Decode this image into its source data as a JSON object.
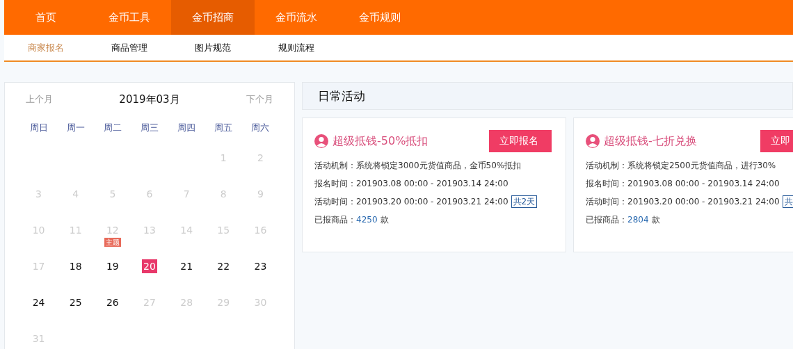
{
  "nav": [
    {
      "label": "首页",
      "selected": false
    },
    {
      "label": "金币工具",
      "selected": false
    },
    {
      "label": "金币招商",
      "selected": true
    },
    {
      "label": "金币流水",
      "selected": false
    },
    {
      "label": "金币规则",
      "selected": false
    }
  ],
  "subnav": [
    {
      "label": "商家报名",
      "selected": true
    },
    {
      "label": "商品管理",
      "selected": false
    },
    {
      "label": "图片规范",
      "selected": false
    },
    {
      "label": "规则流程",
      "selected": false
    }
  ],
  "calendar": {
    "prev": "上个月",
    "title": "2019年03月",
    "next": "下个月",
    "weekdays": [
      "周日",
      "周一",
      "周二",
      "周三",
      "周四",
      "周五",
      "周六"
    ],
    "weeks": [
      [
        {
          "day": "1",
          "available": false,
          "selected": false
        },
        {
          "day": "2",
          "available": false,
          "selected": false
        }
      ],
      [
        {
          "day": "3",
          "available": false,
          "selected": false
        },
        {
          "day": "4",
          "available": false,
          "selected": false
        },
        {
          "day": "5",
          "available": false,
          "selected": false
        },
        {
          "day": "6",
          "available": false,
          "selected": false
        },
        {
          "day": "7",
          "available": false,
          "selected": false
        },
        {
          "day": "8",
          "available": false,
          "selected": false
        },
        {
          "day": "9",
          "available": false,
          "selected": false
        }
      ],
      [
        {
          "day": "10",
          "available": false,
          "selected": false
        },
        {
          "day": "11",
          "available": false,
          "selected": false
        },
        {
          "day": "12",
          "available": false,
          "selected": false,
          "tag": "主题"
        },
        {
          "day": "13",
          "available": false,
          "selected": false
        },
        {
          "day": "14",
          "available": false,
          "selected": false
        },
        {
          "day": "15",
          "available": false,
          "selected": false
        },
        {
          "day": "16",
          "available": false,
          "selected": false
        }
      ],
      [
        {
          "day": "17",
          "available": false,
          "selected": false
        },
        {
          "day": "18",
          "available": true,
          "selected": false
        },
        {
          "day": "19",
          "available": true,
          "selected": false
        },
        {
          "day": "20",
          "available": true,
          "selected": true
        },
        {
          "day": "21",
          "available": true,
          "selected": false
        },
        {
          "day": "22",
          "available": true,
          "selected": false
        },
        {
          "day": "23",
          "available": true,
          "selected": false
        }
      ],
      [
        {
          "day": "24",
          "available": true,
          "selected": false
        },
        {
          "day": "25",
          "available": true,
          "selected": false
        },
        {
          "day": "26",
          "available": true,
          "selected": false
        },
        {
          "day": "27",
          "available": false,
          "selected": false
        },
        {
          "day": "28",
          "available": false,
          "selected": false
        },
        {
          "day": "29",
          "available": false,
          "selected": false
        },
        {
          "day": "30",
          "available": false,
          "selected": false
        }
      ],
      [
        {
          "day": "31",
          "available": false,
          "selected": false
        }
      ]
    ]
  },
  "activities": {
    "title": "日常活动",
    "cards": [
      {
        "title": "超级抵钱-50%抵扣",
        "button": "立即报名",
        "mechanism": "活动机制：系统将锁定3000元货值商品，金币50%抵扣",
        "signup": "报名时间：201903.08 00:00 - 201903.14 24:00",
        "period": "活动时间：201903.20 00:00 - 201903.21 24:00",
        "duration": "共2天",
        "count_label": "已报商品：",
        "count": "4250",
        "count_unit": "款"
      },
      {
        "title": "超级抵钱-七折兑换",
        "button": "立即",
        "mechanism": "活动机制：系统将锁定2500元货值商品，进行30%",
        "signup": "报名时间：201903.08 00:00 - 201903.14 24:00",
        "period": "活动时间：201903.20 00:00 - 201903.21 24:00",
        "duration": "共",
        "count_label": "已报商品：",
        "count": "2804",
        "count_unit": "款"
      }
    ]
  }
}
